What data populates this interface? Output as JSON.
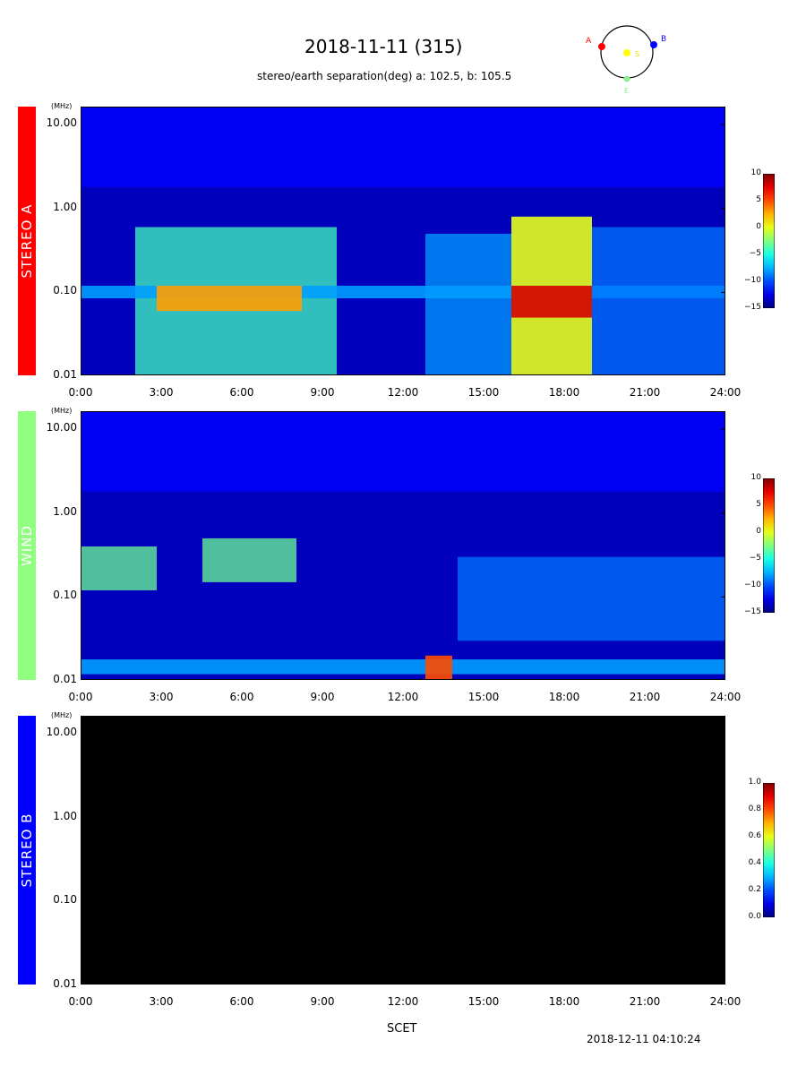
{
  "header": {
    "title": "2018-11-11 (315)",
    "subtitle": "stereo/earth separation(deg) a: 102.5, b: 105.5"
  },
  "orbit_diagram": {
    "labels": {
      "a": "A",
      "b": "B",
      "s": "S",
      "e": "E"
    },
    "colors": {
      "a": "#ff0000",
      "b": "#0000ff",
      "s": "#ffff00",
      "e": "#90ee90"
    }
  },
  "chart_data": [
    {
      "type": "heatmap",
      "panel": "STEREO A",
      "panel_color": "#ff0000",
      "y_unit": "(MHz)",
      "yticks": [
        "10.00",
        "1.00",
        "0.10",
        "0.01"
      ],
      "xticks": [
        "0:00",
        "3:00",
        "6:00",
        "9:00",
        "12:00",
        "15:00",
        "18:00",
        "21:00",
        "24:00"
      ],
      "xlim_hours": [
        0,
        24
      ],
      "ylim_mhz": [
        0.01,
        16
      ],
      "y_scale": "log",
      "colorbar": {
        "ticks": [
          "10",
          "5",
          "0",
          "−5",
          "−10",
          "−15"
        ],
        "range": [
          -15,
          10
        ],
        "colormap": "jet"
      },
      "features": [
        {
          "kind": "burst",
          "start_hour": 2.0,
          "end_hour": 9.5,
          "freq_mhz": [
            0.01,
            0.6
          ],
          "level": -4
        },
        {
          "kind": "band",
          "start_hour": 0,
          "end_hour": 24,
          "freq_mhz": [
            0.085,
            0.12
          ],
          "level": -8
        },
        {
          "kind": "intense",
          "start_hour": 2.8,
          "end_hour": 8.2,
          "freq_mhz": [
            0.06,
            0.12
          ],
          "level": 3
        },
        {
          "kind": "burst",
          "start_hour": 12.8,
          "end_hour": 16.0,
          "freq_mhz": [
            0.01,
            0.5
          ],
          "level": -8
        },
        {
          "kind": "intense",
          "start_hour": 16.0,
          "end_hour": 19.0,
          "freq_mhz": [
            0.01,
            0.8
          ],
          "level": 0
        },
        {
          "kind": "peak",
          "start_hour": 16.0,
          "end_hour": 19.0,
          "freq_mhz": [
            0.05,
            0.12
          ],
          "level": 8
        },
        {
          "kind": "burst",
          "start_hour": 19.0,
          "end_hour": 24,
          "freq_mhz": [
            0.01,
            0.6
          ],
          "level": -9
        }
      ]
    },
    {
      "type": "heatmap",
      "panel": "WIND",
      "panel_color": "#90ff80",
      "y_unit": "(MHz)",
      "yticks": [
        "10.00",
        "1.00",
        "0.10",
        "0.01"
      ],
      "xticks": [
        "0:00",
        "3:00",
        "6:00",
        "9:00",
        "12:00",
        "15:00",
        "18:00",
        "21:00",
        "24:00"
      ],
      "xlim_hours": [
        0,
        24
      ],
      "ylim_mhz": [
        0.01,
        16
      ],
      "y_scale": "log",
      "colorbar": {
        "ticks": [
          "10",
          "5",
          "0",
          "−5",
          "−10",
          "−15"
        ],
        "range": [
          -15,
          10
        ],
        "colormap": "jet"
      },
      "features": [
        {
          "kind": "burst",
          "start_hour": 0,
          "end_hour": 2.8,
          "freq_mhz": [
            0.12,
            0.4
          ],
          "level": -3
        },
        {
          "kind": "burst",
          "start_hour": 4.5,
          "end_hour": 8.0,
          "freq_mhz": [
            0.15,
            0.5
          ],
          "level": -3
        },
        {
          "kind": "band",
          "start_hour": 0,
          "end_hour": 24,
          "freq_mhz": [
            0.012,
            0.018
          ],
          "level": -8
        },
        {
          "kind": "burst",
          "start_hour": 14.0,
          "end_hour": 24,
          "freq_mhz": [
            0.03,
            0.3
          ],
          "level": -9
        },
        {
          "kind": "intense",
          "start_hour": 12.8,
          "end_hour": 13.8,
          "freq_mhz": [
            0.01,
            0.02
          ],
          "level": 5
        }
      ]
    },
    {
      "type": "heatmap",
      "panel": "STEREO B",
      "panel_color": "#0000ff",
      "y_unit": "(MHz)",
      "yticks": [
        "10.00",
        "1.00",
        "0.10",
        "0.01"
      ],
      "xticks": [
        "0:00",
        "3:00",
        "6:00",
        "9:00",
        "12:00",
        "15:00",
        "18:00",
        "21:00",
        "24:00"
      ],
      "xlim_hours": [
        0,
        24
      ],
      "ylim_mhz": [
        0.01,
        16
      ],
      "y_scale": "log",
      "colorbar": {
        "ticks": [
          "1.0",
          "0.8",
          "0.6",
          "0.4",
          "0.2",
          "0.0"
        ],
        "range": [
          0,
          1
        ],
        "colormap": "jet"
      },
      "features": []
    }
  ],
  "footer": {
    "xlabel": "SCET",
    "timestamp": "2018-12-11 04:10:24"
  }
}
